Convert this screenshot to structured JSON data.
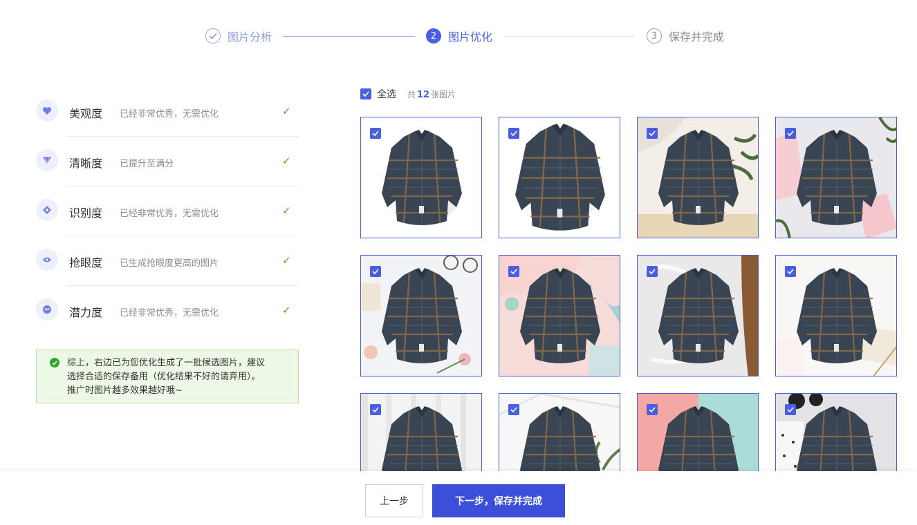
{
  "colors": {
    "accent": "#4a5fe0",
    "success": "#3fae2a",
    "summary_bg": "#edf8e6",
    "summary_border": "#b9e2a6"
  },
  "steps": [
    {
      "index": "1",
      "label": "图片分析",
      "state": "done",
      "icon": "check-icon"
    },
    {
      "index": "2",
      "label": "图片优化",
      "state": "active"
    },
    {
      "index": "3",
      "label": "保存并完成",
      "state": "todo"
    }
  ],
  "metrics": [
    {
      "name": "美观度",
      "desc": "已经非常优秀，无需优化",
      "icon": "heart-icon"
    },
    {
      "name": "清晰度",
      "desc": "已提升至满分",
      "icon": "diamond-icon"
    },
    {
      "name": "识别度",
      "desc": "已经非常优秀，无需优化",
      "icon": "target-icon"
    },
    {
      "name": "抢眼度",
      "desc": "已生成抢眼度更高的图片",
      "icon": "eye-icon"
    },
    {
      "name": "潜力度",
      "desc": "已经非常优秀，无需优化",
      "icon": "trend-icon"
    }
  ],
  "summary": {
    "line1": "综上，右边已为您优化生成了一批候选图片，建议",
    "line2": "选择合适的保存备用（优化结果不好的请弃用）。",
    "line3": "推广时图片越多效果越好哦~"
  },
  "gallery": {
    "select_all_label": "全选",
    "count_prefix": "共",
    "count": "12",
    "count_suffix": "张图片",
    "images": [
      {
        "bg": "white"
      },
      {
        "bg": "white"
      },
      {
        "bg": "cream knit with plant"
      },
      {
        "bg": "light gray with pink paper"
      },
      {
        "bg": "white fabric with glasses and flowers"
      },
      {
        "bg": "pink with mint accessories"
      },
      {
        "bg": "white fur on wood"
      },
      {
        "bg": "white with notebook"
      },
      {
        "bg": "white wood planks"
      },
      {
        "bg": "white with plant"
      },
      {
        "bg": "pink and mint split"
      },
      {
        "bg": "gray with dotted fabric and sunglasses"
      }
    ]
  },
  "footer": {
    "prev_label": "上一步",
    "next_label": "下一步，保存并完成"
  }
}
